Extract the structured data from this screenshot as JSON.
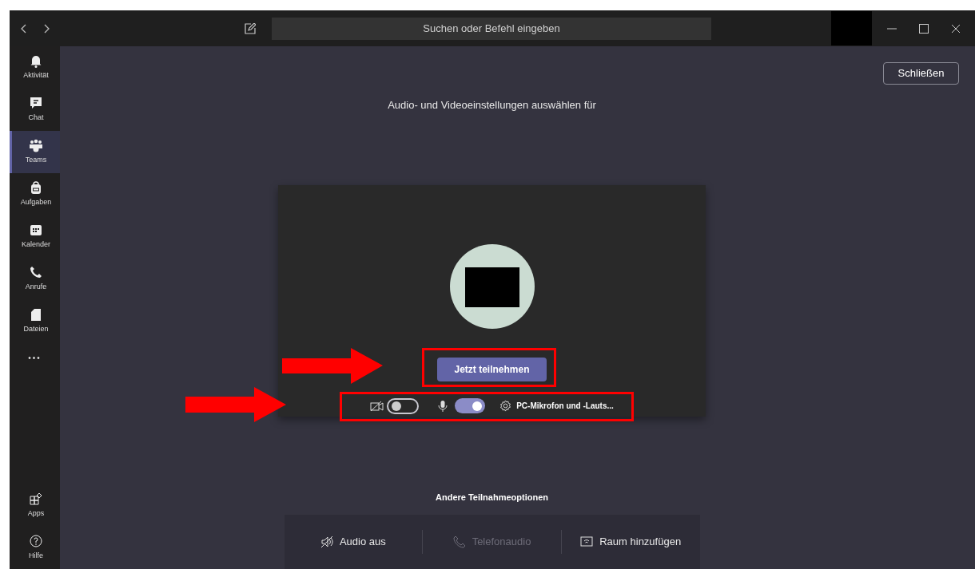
{
  "title_bar": {
    "search_placeholder": "Suchen oder Befehl eingeben"
  },
  "sidebar": {
    "items": [
      {
        "label": "Aktivität",
        "selected": false
      },
      {
        "label": "Chat",
        "selected": false
      },
      {
        "label": "Teams",
        "selected": true
      },
      {
        "label": "Aufgaben",
        "selected": false
      },
      {
        "label": "Kalender",
        "selected": false
      },
      {
        "label": "Anrufe",
        "selected": false
      },
      {
        "label": "Dateien",
        "selected": false
      }
    ],
    "more": "•••",
    "bottom_items": [
      {
        "label": "Apps",
        "selected": false
      },
      {
        "label": "Hilfe",
        "selected": false
      }
    ]
  },
  "close_button": "Schließen",
  "heading": "Audio- und Videoeinstellungen auswählen für",
  "preview": {
    "join_button": "Jetzt teilnehmen",
    "camera_toggle": {
      "on": false
    },
    "mic_toggle": {
      "on": true
    },
    "device": "PC-Mikrofon und -Lauts..."
  },
  "other_options": {
    "title": "Andere Teilnahmeoptionen",
    "options": [
      {
        "label": "Audio aus",
        "disabled": false
      },
      {
        "label": "Telefonaudio",
        "disabled": true
      },
      {
        "label": "Raum hinzufügen",
        "disabled": false
      }
    ]
  }
}
